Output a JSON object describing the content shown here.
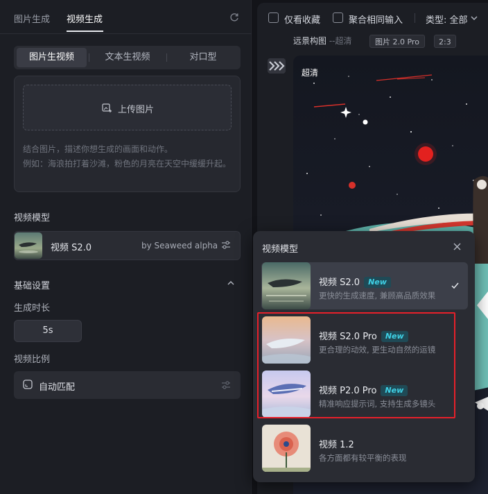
{
  "left_panel": {
    "tabs": [
      {
        "label": "图片生成"
      },
      {
        "label": "视频生成"
      }
    ],
    "modes": [
      {
        "label": "图片生视频"
      },
      {
        "label": "文本生视频"
      },
      {
        "label": "对口型"
      }
    ],
    "upload": {
      "button_label": "上传图片",
      "hint_line1": "结合图片，描述你想生成的画面和动作。",
      "hint_line2": "例如：海浪拍打着沙滩，粉色的月亮在天空中缓缓升起。"
    },
    "model_section": {
      "label": "视频模型",
      "selected_name": "视频 S2.0",
      "selected_by": "by Seaweed alpha"
    },
    "basic_settings": {
      "label": "基础设置",
      "duration_label": "生成时长",
      "duration_value": "5s",
      "ratio_label": "视频比例",
      "ratio_value": "自动匹配"
    }
  },
  "right_panel": {
    "filters": {
      "favorites_label": "仅看收藏",
      "merge_label": "聚合相同输入",
      "type_label": "类型: 全部"
    },
    "record": {
      "prompt": "远景构图",
      "prompt_suffix": "--超清",
      "model_badge": "图片 2.0 Pro",
      "ratio_badge": "2:3",
      "image_label": "超清"
    }
  },
  "model_dropdown": {
    "title": "视频模型",
    "new_badge": "New",
    "options": [
      {
        "name": "视频 S2.0",
        "desc": "更快的生成速度, 兼顾高品质效果",
        "is_new": true,
        "selected": true
      },
      {
        "name": "视频 S2.0 Pro",
        "desc": "更合理的动效, 更生动自然的运镜",
        "is_new": true,
        "selected": false
      },
      {
        "name": "视频 P2.0 Pro",
        "desc": "精准响应提示词, 支持生成多镜头",
        "is_new": true,
        "selected": false
      },
      {
        "name": "视频 1.2",
        "desc": "各方面都有较平衡的表现",
        "is_new": false,
        "selected": false
      }
    ]
  },
  "icons": {
    "refresh": "refresh-icon",
    "upload": "image-add-icon",
    "settings": "sliders-icon",
    "collapse": "chevron-up-icon",
    "close": "close-icon",
    "check": "check-icon",
    "chevron": "chevron-down-icon"
  },
  "colors": {
    "accent_new": "#3fd1e6",
    "highlight": "#e8202a",
    "panel_bg": "#1c1e24"
  }
}
